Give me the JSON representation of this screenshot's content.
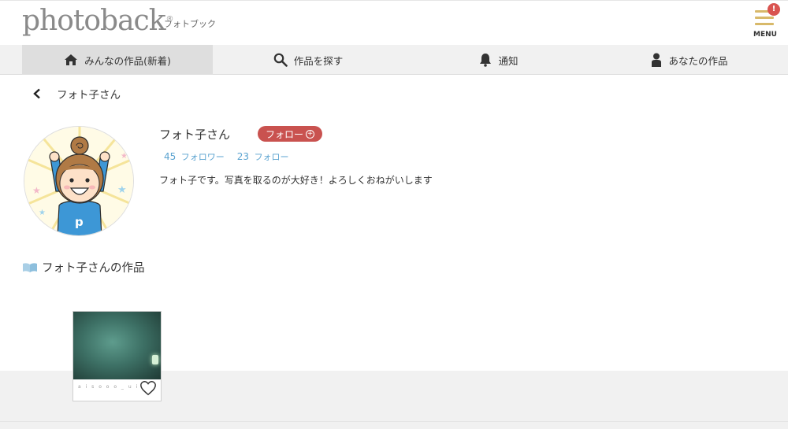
{
  "header": {
    "logo_text": "photoback",
    "logo_reg": "®",
    "logo_sub": "フォトブック",
    "menu_label": "MENU",
    "menu_badge": "!"
  },
  "nav": {
    "items": [
      {
        "label": "みんなの作品(新着)",
        "icon": "home-icon",
        "active": true
      },
      {
        "label": "作品を探す",
        "icon": "search-icon",
        "active": false
      },
      {
        "label": "通知",
        "icon": "bell-icon",
        "active": false
      },
      {
        "label": "あなたの作品",
        "icon": "person-icon",
        "active": false
      }
    ]
  },
  "breadcrumb": {
    "back_icon": "chevron-left-icon",
    "title": "フォト子さん"
  },
  "profile": {
    "name": "フォト子さん",
    "follow_label": "フォロー",
    "followers_count": "45",
    "followers_label": "フォロワー",
    "following_count": "23",
    "following_label": "フォロー",
    "bio": "フォト子です。写真を取るのが大好き！よろしくおねがいします"
  },
  "works": {
    "heading": "フォト子さんの作品",
    "heading_icon": "book-icon",
    "items": [
      {
        "caption": "a i s o o o _ u i",
        "favorite_icon": "heart-icon"
      }
    ]
  },
  "colors": {
    "follow_button": "#c9524f",
    "stat_link": "#5ba3d0",
    "menu_bar": "#d8b96a",
    "badge": "#d9534f",
    "nav_bg": "#f1f1f1",
    "nav_active_bg": "#dedede"
  }
}
